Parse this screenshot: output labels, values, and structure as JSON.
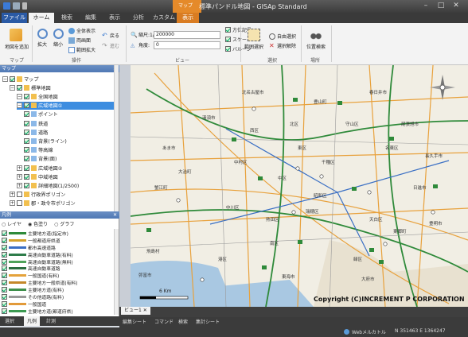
{
  "window": {
    "title": "標準パンドル地図 - GISAp Standard",
    "context_tab": "マップ"
  },
  "tabs": [
    "ファイル",
    "ホーム",
    "検索",
    "編集",
    "表示",
    "分析",
    "カスタム",
    "表示"
  ],
  "ribbon": {
    "add_map": "地図を追加",
    "group_map": "マップ",
    "zoom_in": "拡大",
    "zoom_out": "縮小",
    "full_view": "全体表示",
    "two_screens": "両画面",
    "range_zoom": "範囲拡大",
    "back": "戻る",
    "forward": "進む",
    "group_ops": "操作",
    "scale_label": "縮尺:1/",
    "scale_value": "200000",
    "angle_label": "角度:",
    "angle_value": "0",
    "group_view": "ビュー",
    "north_arrow": "方位記号",
    "scale_bar": "スケールバー",
    "balloon": "バルーン",
    "range_select": "範囲選択",
    "free_select": "自由選択",
    "clear_select": "選択解除",
    "group_select": "選択",
    "location_search": "位置検索",
    "group_place": "場所"
  },
  "map_panel": {
    "header": "マップ",
    "tree": [
      {
        "label": "マップ",
        "indent": 0,
        "checked": true,
        "selected": false
      },
      {
        "label": "標準地図",
        "indent": 1,
        "checked": true,
        "selected": false
      },
      {
        "label": "全国地図",
        "indent": 2,
        "checked": true,
        "selected": false
      },
      {
        "label": "広域地図①",
        "indent": 2,
        "checked": true,
        "selected": true
      },
      {
        "label": "ポイント",
        "indent": 3,
        "checked": true,
        "selected": false
      },
      {
        "label": "鉄道",
        "indent": 3,
        "checked": true,
        "selected": false
      },
      {
        "label": "道路",
        "indent": 3,
        "checked": true,
        "selected": false
      },
      {
        "label": "背景(ライン)",
        "indent": 3,
        "checked": true,
        "selected": false
      },
      {
        "label": "等高線",
        "indent": 3,
        "checked": true,
        "selected": false
      },
      {
        "label": "背景(面)",
        "indent": 3,
        "checked": true,
        "selected": false
      },
      {
        "label": "広域地図②",
        "indent": 2,
        "checked": true,
        "selected": false
      },
      {
        "label": "中域地図",
        "indent": 2,
        "checked": true,
        "selected": false
      },
      {
        "label": "詳細地図(1/2500)",
        "indent": 2,
        "checked": true,
        "selected": false
      },
      {
        "label": "行政界ポリゴン",
        "indent": 1,
        "checked": false,
        "selected": false
      },
      {
        "label": "郡・政令市ポリゴン",
        "indent": 1,
        "checked": false,
        "selected": false
      }
    ]
  },
  "legend_panel": {
    "header": "凡例",
    "radios": [
      "レイヤ",
      "色塗り",
      "グラフ"
    ],
    "items": [
      {
        "label": "主要地方道(指定市)",
        "color": "#2f8a3a"
      },
      {
        "label": "一般都道府県道",
        "color": "#d3a12a"
      },
      {
        "label": "都市高速道路",
        "color": "#3a6fc4"
      },
      {
        "label": "高速自動車道路(有料)",
        "color": "#2e7c4a"
      },
      {
        "label": "高速自動車道路(無料)",
        "color": "#4fa35a"
      },
      {
        "label": "高速自動車道路",
        "color": "#2b6e3f"
      },
      {
        "label": "一般国道(有料)",
        "color": "#e4a23b"
      },
      {
        "label": "主要地方一般県道(有料)",
        "color": "#c4882a"
      },
      {
        "label": "主要地方道(有料)",
        "color": "#3e8f4b"
      },
      {
        "label": "その他道路(有料)",
        "color": "#999999"
      },
      {
        "label": "一般国道",
        "color": "#e29a3a"
      },
      {
        "label": "主要地方道(都道府県)",
        "color": "#3c9a52"
      }
    ]
  },
  "panel_tabs": [
    "選択",
    "凡例",
    "計測"
  ],
  "bottom_tabs": [
    "ビュー1",
    "編集シート",
    "コマンド",
    "検索",
    "集計シート"
  ],
  "map": {
    "copyright": "Copyright (C)INCREMENT P CORPORATION",
    "scale_label": "6 Km",
    "labels": [
      {
        "text": "北名古屋市"
      },
      {
        "text": "豊山町"
      },
      {
        "text": "春日井市"
      },
      {
        "text": "清須市"
      },
      {
        "text": "西区"
      },
      {
        "text": "北区"
      },
      {
        "text": "守山区"
      },
      {
        "text": "あま市"
      },
      {
        "text": "中村区"
      },
      {
        "text": "東区"
      },
      {
        "text": "千種区"
      },
      {
        "text": "名東区"
      },
      {
        "text": "中区"
      },
      {
        "text": "昭和区"
      },
      {
        "text": "天白区"
      },
      {
        "text": "中川区"
      },
      {
        "text": "熱田区"
      },
      {
        "text": "瑞穂区"
      },
      {
        "text": "南区"
      },
      {
        "text": "緑区"
      },
      {
        "text": "港区"
      },
      {
        "text": "蟹江町"
      },
      {
        "text": "大治町"
      },
      {
        "text": "日進市"
      },
      {
        "text": "長久手市"
      },
      {
        "text": "東郷町"
      },
      {
        "text": "豊明市"
      },
      {
        "text": "大府市"
      },
      {
        "text": "東海市"
      },
      {
        "text": "飛島村"
      },
      {
        "text": "弥富市"
      },
      {
        "text": "尾張旭市"
      }
    ]
  },
  "status": {
    "label": "Webメルカトル",
    "coords": "N 351463 E 1364247"
  },
  "colors": {
    "ribbon_accent": "#e58a2a",
    "selection": "#3d8de0",
    "panel_header": "#4f78b4"
  }
}
